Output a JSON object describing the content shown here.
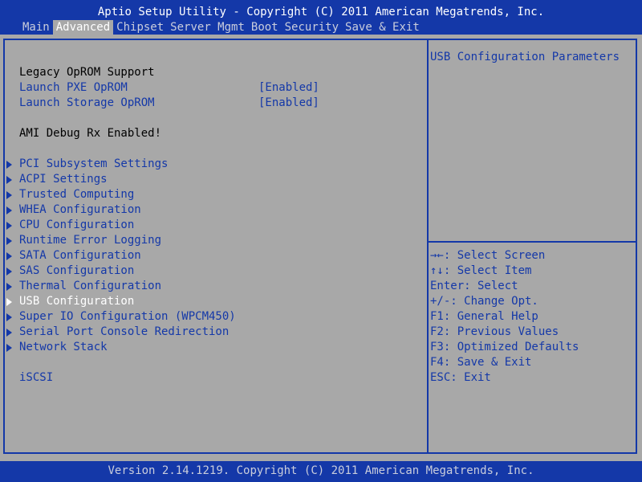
{
  "header": {
    "title": "Aptio Setup Utility - Copyright (C) 2011 American Megatrends, Inc.",
    "tabs": [
      "Main",
      "Advanced",
      "Chipset",
      "Server Mgmt",
      "Boot",
      "Security",
      "Save & Exit"
    ],
    "active_tab": "Advanced"
  },
  "main": {
    "legacy_heading": "Legacy OpROM Support",
    "pxe": {
      "label": "Launch PXE OpROM",
      "value": "[Enabled]"
    },
    "storage": {
      "label": "Launch Storage OpROM",
      "value": "[Enabled]"
    },
    "debug_text": "AMI Debug Rx Enabled!",
    "menu_items": [
      "PCI Subsystem Settings",
      "ACPI Settings",
      "Trusted Computing",
      "WHEA Configuration",
      "CPU Configuration",
      "Runtime Error Logging",
      "SATA Configuration",
      "SAS Configuration",
      "Thermal Configuration",
      "USB Configuration",
      "Super IO Configuration (WPCM450)",
      "Serial Port Console Redirection",
      "Network Stack"
    ],
    "selected_item": "USB Configuration",
    "iscsi": "iSCSI"
  },
  "help": {
    "description": "USB Configuration Parameters",
    "keys": [
      "→←: Select Screen",
      "↑↓: Select Item",
      "Enter: Select",
      "+/-: Change Opt.",
      "F1: General Help",
      "F2: Previous Values",
      "F3: Optimized Defaults",
      "F4: Save & Exit",
      "ESC: Exit"
    ]
  },
  "footer": {
    "version": "Version 2.14.1219. Copyright (C) 2011 American Megatrends, Inc."
  },
  "colors": {
    "background": "#a8a8a8",
    "bar": "#1438a8",
    "text_blue": "#1438a8",
    "text_white": "#ffffff"
  }
}
